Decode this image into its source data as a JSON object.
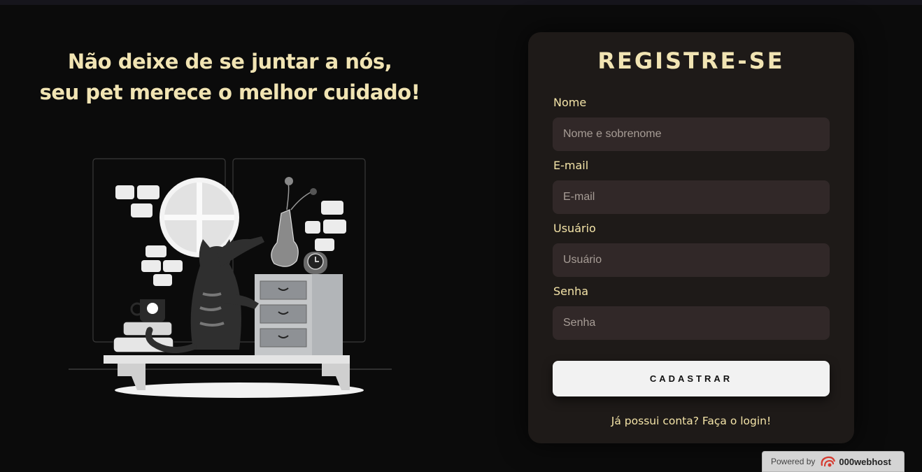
{
  "headline": {
    "line1": "Não deixe de se juntar a nós,",
    "line2": "seu pet merece o melhor cuidado!"
  },
  "form": {
    "title": "REGISTRE-SE",
    "fields": {
      "name": {
        "label": "Nome",
        "placeholder": "Nome e sobrenome"
      },
      "email": {
        "label": "E-mail",
        "placeholder": "E-mail"
      },
      "user": {
        "label": "Usuário",
        "placeholder": "Usuário"
      },
      "password": {
        "label": "Senha",
        "placeholder": "Senha"
      }
    },
    "submit_label": "CADASTRAR",
    "login_link": "Já possui conta? Faça o login!"
  },
  "footer": {
    "powered_by": "Powered by",
    "brand": "000webhost",
    "brand_icon": "000webhost-logo-icon"
  },
  "colors": {
    "background": "#0b0b0b",
    "card": "#1e1a18",
    "accent_text": "#f1e4b3",
    "input_bg": "#312828",
    "button_bg": "#f2f2f2"
  },
  "illustration": "cat-at-window-illustration"
}
